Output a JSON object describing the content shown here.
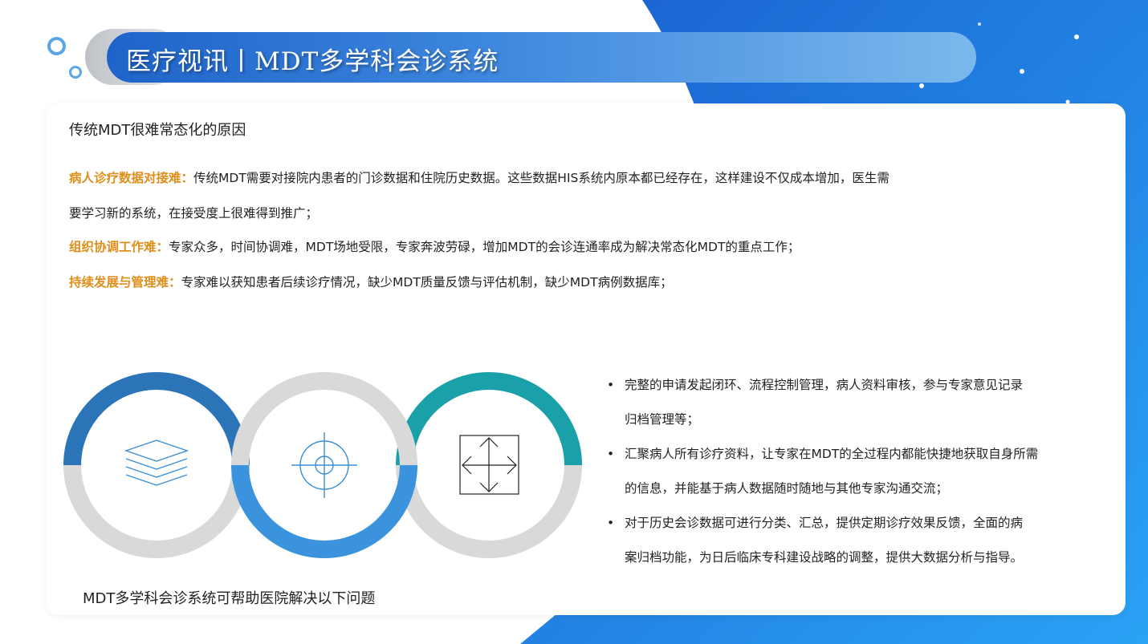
{
  "header": {
    "title": "医疗视讯丨MDT多学科会诊系统"
  },
  "colors": {
    "accent_blue": "#1f63c9",
    "label_orange": "#e08e1a",
    "ring_dark_blue": "#2b74b8",
    "ring_mid_blue": "#3a93dc",
    "ring_teal": "#1aa0a8",
    "ring_gray": "#d9d9d9"
  },
  "card": {
    "heading": "传统MDT很难常态化的原因",
    "items": [
      {
        "label": "病人诊疗数据对接难：",
        "text": "传统MDT需要对接院内患者的门诊数据和住院历史数据。这些数据HIS系统内原本都已经存在，这样建设不仅成本增加，医生需",
        "text2": "要学习新的系统，在接受度上很难得到推广；"
      },
      {
        "label": "组织协调工作难：",
        "text": "专家众多，时间协调难，MDT场地受限，专家奔波劳碌，增加MDT的会诊连通率成为解决常态化MDT的重点工作；"
      },
      {
        "label": "持续发展与管理难：",
        "text": "专家难以获知患者后续诊疗情况，缺少MDT质量反馈与评估机制，缺少MDT病例数据库；"
      }
    ],
    "bottom_caption": "MDT多学科会诊系统可帮助医院解决以下问题",
    "bullet_char": "•",
    "bullets": [
      {
        "line1": "完整的申请发起闭环、流程控制管理，病人资料审核，参与专家意见记录",
        "line2": "归档管理等；"
      },
      {
        "line1": "汇聚病人所有诊疗资料，让专家在MDT的全过程内都能快捷地获取自身所需",
        "line2": "的信息，并能基于病人数据随时随地与其他专家沟通交流；"
      },
      {
        "line1": "对于历史会诊数据可进行分类、汇总，提供定期诊疗效果反馈，全面的病",
        "line2": "案归档功能，为日后临床专科建设战略的调整，提供大数据分析与指导。"
      }
    ]
  },
  "icons": [
    "layers-icon",
    "target-icon",
    "expand-arrows-icon"
  ]
}
